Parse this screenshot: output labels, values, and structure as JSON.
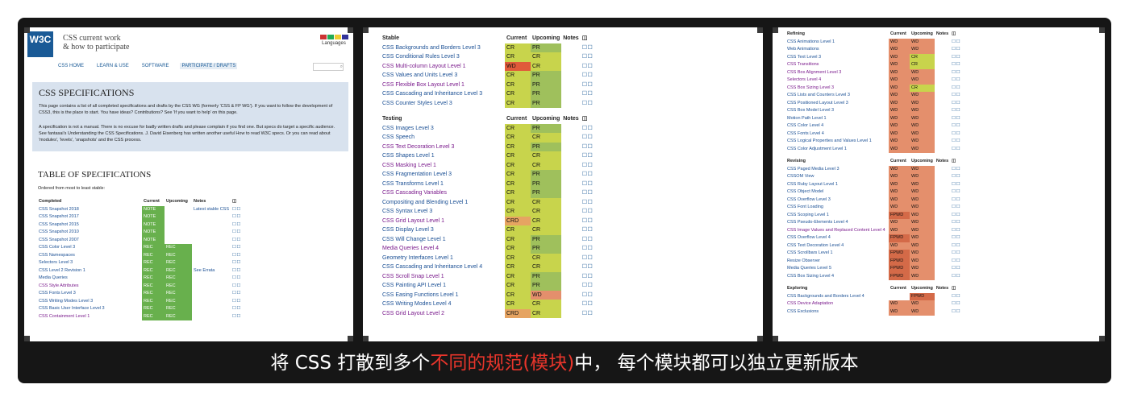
{
  "colors": {
    "NOTE": "#68b04d",
    "REC": "#68b04d",
    "CR": "#c8d44c",
    "PR": "#9fc05c",
    "WD": "#e48f6c",
    "FPWD": "#d46a48",
    "CRD": "#e6a462",
    "redWD": "#e05a3a"
  },
  "panel1": {
    "logo": "W3C",
    "site_title_1": "CSS current work",
    "site_title_2": "& how to participate",
    "languages": "Languages",
    "nav": [
      "CSS HOME",
      "LEARN & USE",
      "SOFTWARE",
      "PARTICIPATE / DRAFTS"
    ],
    "spec_heading": "CSS SPECIFICATIONS",
    "intro1": "This page contains a list of all completed specifications and drafts by the CSS WG (formerly 'CSS & FP WG'). If you want to follow the development of CSS3, this is the place to start. You have ideas? Contributions? See 'If you want to help' on this page.",
    "intro2": "A specification is not a manual. There is no excuse for badly written drafts and please complain if you find one. But specs do target a specific audience. See fantasai's Understanding the CSS Specifications. J. David Eisenberg has written another useful How to read W3C specs. Or you can read about 'modules', 'levels', 'snapshots' and the CSS process.",
    "tos_heading": "TABLE OF SPECIFICATIONS",
    "ordered": "Ordered from most to least stable:",
    "headers": [
      "Completed",
      "Current",
      "Upcoming",
      "Notes"
    ],
    "rows": [
      {
        "name": "CSS Snapshot 2018",
        "cur": "NOTE",
        "up": "",
        "note": "Latest stable CSS",
        "v": false
      },
      {
        "name": "CSS Snapshot 2017",
        "cur": "NOTE",
        "up": "",
        "note": "",
        "v": false
      },
      {
        "name": "CSS Snapshot 2015",
        "cur": "NOTE",
        "up": "",
        "note": "",
        "v": false
      },
      {
        "name": "CSS Snapshot 2010",
        "cur": "NOTE",
        "up": "",
        "note": "",
        "v": false
      },
      {
        "name": "CSS Snapshot 2007",
        "cur": "NOTE",
        "up": "",
        "note": "",
        "v": false
      },
      {
        "name": "CSS Color Level 3",
        "cur": "REC",
        "up": "REC",
        "note": "",
        "v": false
      },
      {
        "name": "CSS Namespaces",
        "cur": "REC",
        "up": "REC",
        "note": "",
        "v": false
      },
      {
        "name": "Selectors Level 3",
        "cur": "REC",
        "up": "REC",
        "note": "",
        "v": false
      },
      {
        "name": "CSS Level 2 Revision 1",
        "cur": "REC",
        "up": "REC",
        "note": "See Errata",
        "v": false
      },
      {
        "name": "Media Queries",
        "cur": "REC",
        "up": "REC",
        "note": "",
        "v": false
      },
      {
        "name": "CSS Style Attributes",
        "cur": "REC",
        "up": "REC",
        "note": "",
        "v": true
      },
      {
        "name": "CSS Fonts Level 3",
        "cur": "REC",
        "up": "REC",
        "note": "",
        "v": false
      },
      {
        "name": "CSS Writing Modes Level 3",
        "cur": "REC",
        "up": "REC",
        "note": "",
        "v": false
      },
      {
        "name": "CSS Basic User Interface Level 3",
        "cur": "REC",
        "up": "REC",
        "note": "",
        "v": false
      },
      {
        "name": "CSS Containment Level 1",
        "cur": "REC",
        "up": "REC",
        "note": "",
        "v": true
      }
    ]
  },
  "panel2": {
    "sections": [
      {
        "title": "Stable",
        "headers": [
          "Current",
          "Upcoming",
          "Notes"
        ],
        "rows": [
          {
            "name": "CSS Backgrounds and Borders Level 3",
            "cur": "CR",
            "up": "PR",
            "v": false
          },
          {
            "name": "CSS Conditional Rules Level 3",
            "cur": "CR",
            "up": "CR",
            "v": false
          },
          {
            "name": "CSS Multi-column Layout Level 1",
            "cur": "WD",
            "up": "CR",
            "v": true
          },
          {
            "name": "CSS Values and Units Level 3",
            "cur": "CR",
            "up": "PR",
            "v": false
          },
          {
            "name": "CSS Flexible Box Layout Level 1",
            "cur": "CR",
            "up": "PR",
            "v": true
          },
          {
            "name": "CSS Cascading and Inheritance Level 3",
            "cur": "CR",
            "up": "PR",
            "v": false
          },
          {
            "name": "CSS Counter Styles Level 3",
            "cur": "CR",
            "up": "PR",
            "v": false
          }
        ]
      },
      {
        "title": "Testing",
        "headers": [
          "Current",
          "Upcoming",
          "Notes"
        ],
        "rows": [
          {
            "name": "CSS Images Level 3",
            "cur": "CR",
            "up": "PR",
            "v": false
          },
          {
            "name": "CSS Speech",
            "cur": "CR",
            "up": "CR",
            "v": false
          },
          {
            "name": "CSS Text Decoration Level 3",
            "cur": "CR",
            "up": "PR",
            "v": true
          },
          {
            "name": "CSS Shapes Level 1",
            "cur": "CR",
            "up": "CR",
            "v": false
          },
          {
            "name": "CSS Masking Level 1",
            "cur": "CR",
            "up": "CR",
            "v": true
          },
          {
            "name": "CSS Fragmentation Level 3",
            "cur": "CR",
            "up": "PR",
            "v": false
          },
          {
            "name": "CSS Transforms Level 1",
            "cur": "CR",
            "up": "PR",
            "v": false
          },
          {
            "name": "CSS Cascading Variables",
            "cur": "CR",
            "up": "PR",
            "v": true
          },
          {
            "name": "Compositing and Blending Level 1",
            "cur": "CR",
            "up": "CR",
            "v": false
          },
          {
            "name": "CSS Syntax Level 3",
            "cur": "CR",
            "up": "CR",
            "v": false
          },
          {
            "name": "CSS Grid Layout Level 1",
            "cur": "CRD",
            "up": "CR",
            "v": true
          },
          {
            "name": "CSS Display Level 3",
            "cur": "CR",
            "up": "CR",
            "v": false
          },
          {
            "name": "CSS Will Change Level 1",
            "cur": "CR",
            "up": "PR",
            "v": false
          },
          {
            "name": "Media Queries Level 4",
            "cur": "CR",
            "up": "PR",
            "v": true
          },
          {
            "name": "Geometry Interfaces Level 1",
            "cur": "CR",
            "up": "CR",
            "v": false
          },
          {
            "name": "CSS Cascading and Inheritance Level 4",
            "cur": "CR",
            "up": "CR",
            "v": false
          },
          {
            "name": "CSS Scroll Snap Level 1",
            "cur": "CR",
            "up": "PR",
            "v": true
          },
          {
            "name": "CSS Painting API Level 1",
            "cur": "CR",
            "up": "PR",
            "v": false
          },
          {
            "name": "CSS Easing Functions Level 1",
            "cur": "CR",
            "up": "WD",
            "v": false
          },
          {
            "name": "CSS Writing Modes Level 4",
            "cur": "CR",
            "up": "CR",
            "v": false
          },
          {
            "name": "CSS Grid Layout Level 2",
            "cur": "CRD",
            "up": "CR",
            "v": true
          }
        ]
      }
    ]
  },
  "panel3": {
    "sections": [
      {
        "title": "Refining",
        "headers": [
          "Current",
          "Upcoming",
          "Notes"
        ],
        "rows": [
          {
            "name": "CSS Animations Level 1",
            "cur": "WD",
            "up": "WD",
            "v": false
          },
          {
            "name": "Web Animations",
            "cur": "WD",
            "up": "WD",
            "v": false
          },
          {
            "name": "CSS Text Level 3",
            "cur": "WD",
            "up": "CR",
            "v": false
          },
          {
            "name": "CSS Transitions",
            "cur": "WD",
            "up": "CR",
            "v": true
          },
          {
            "name": "CSS Box Alignment Level 3",
            "cur": "WD",
            "up": "WD",
            "v": true
          },
          {
            "name": "Selectors Level 4",
            "cur": "WD",
            "up": "WD",
            "v": true
          },
          {
            "name": "CSS Box Sizing Level 3",
            "cur": "WD",
            "up": "CR",
            "v": true
          },
          {
            "name": "CSS Lists and Counters Level 3",
            "cur": "WD",
            "up": "WD",
            "v": false
          },
          {
            "name": "CSS Positioned Layout Level 3",
            "cur": "WD",
            "up": "WD",
            "v": false
          },
          {
            "name": "CSS Box Model Level 3",
            "cur": "WD",
            "up": "WD",
            "v": false
          },
          {
            "name": "Motion Path Level 1",
            "cur": "WD",
            "up": "WD",
            "v": false
          },
          {
            "name": "CSS Color Level 4",
            "cur": "WD",
            "up": "WD",
            "v": false
          },
          {
            "name": "CSS Fonts Level 4",
            "cur": "WD",
            "up": "WD",
            "v": false
          },
          {
            "name": "CSS Logical Properties and Values Level 1",
            "cur": "WD",
            "up": "WD",
            "v": false
          },
          {
            "name": "CSS Color Adjustment Level 1",
            "cur": "WD",
            "up": "WD",
            "v": false
          }
        ]
      },
      {
        "title": "Revising",
        "headers": [
          "Current",
          "Upcoming",
          "Notes"
        ],
        "rows": [
          {
            "name": "CSS Paged Media Level 3",
            "cur": "WD",
            "up": "WD",
            "v": false
          },
          {
            "name": "CSSOM View",
            "cur": "WD",
            "up": "WD",
            "v": false
          },
          {
            "name": "CSS Ruby Layout Level 1",
            "cur": "WD",
            "up": "WD",
            "v": false
          },
          {
            "name": "CSS Object Model",
            "cur": "WD",
            "up": "WD",
            "v": false
          },
          {
            "name": "CSS Overflow Level 3",
            "cur": "WD",
            "up": "WD",
            "v": false
          },
          {
            "name": "CSS Font Loading",
            "cur": "WD",
            "up": "WD",
            "v": false
          },
          {
            "name": "CSS Scoping Level 1",
            "cur": "FPWD",
            "up": "WD",
            "v": false
          },
          {
            "name": "CSS Pseudo-Elements Level 4",
            "cur": "WD",
            "up": "WD",
            "v": false
          },
          {
            "name": "CSS Image Values and Replaced Content Level 4",
            "cur": "WD",
            "up": "WD",
            "v": true
          },
          {
            "name": "CSS Overflow Level 4",
            "cur": "FPWD",
            "up": "WD",
            "v": false
          },
          {
            "name": "CSS Text Decoration Level 4",
            "cur": "WD",
            "up": "WD",
            "v": false
          },
          {
            "name": "CSS Scrollbars Level 1",
            "cur": "FPWD",
            "up": "WD",
            "v": false
          },
          {
            "name": "Resize Observer",
            "cur": "FPWD",
            "up": "WD",
            "v": false
          },
          {
            "name": "Media Queries Level 5",
            "cur": "FPWD",
            "up": "WD",
            "v": false
          },
          {
            "name": "CSS Box Sizing Level 4",
            "cur": "FPWD",
            "up": "WD",
            "v": false
          }
        ]
      },
      {
        "title": "Exploring",
        "headers": [
          "Current",
          "Upcoming",
          "Notes"
        ],
        "rows": [
          {
            "name": "CSS Backgrounds and Borders Level 4",
            "cur": "",
            "up": "FPWD",
            "v": false
          },
          {
            "name": "CSS Device Adaptation",
            "cur": "WD",
            "up": "WD",
            "v": true
          },
          {
            "name": "CSS Exclusions",
            "cur": "WD",
            "up": "WD",
            "v": false
          }
        ]
      }
    ]
  },
  "caption": {
    "before": "将 CSS 打散到多个",
    "highlight": "不同的规范(模块)",
    "after": "中， 每个模块都可以独立更新版本"
  }
}
